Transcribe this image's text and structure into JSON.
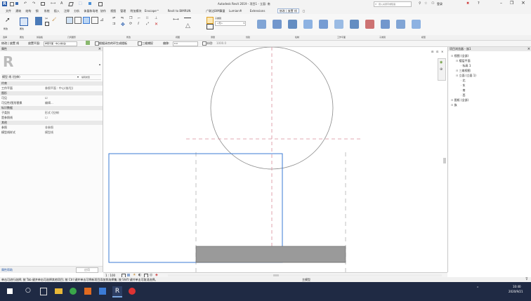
{
  "app": {
    "window_title": "Autodesk Revit 2019 - 项目1 - 立面: 南",
    "search_placeholder": "键入关键字或短语",
    "user": "登录",
    "help": "?"
  },
  "ribbon": {
    "tabs": [
      "文件",
      "建筑",
      "结构",
      "钢",
      "系统",
      "插入",
      "注释",
      "分析",
      "体量和场地",
      "协作",
      "视图",
      "管理",
      "附加模块",
      "Enscape™",
      "Revit to BIMRUN",
      "广联达BIM算量",
      "Lumion®",
      "Extensions",
      "修改 | 放置 线",
      "▢"
    ],
    "active_tab": "修改 | 放置 线",
    "groups": [
      "选择",
      "属性",
      "剪贴板",
      "几何图形",
      "修改",
      "视图",
      "测量",
      "创建",
      "绘制",
      "工作平面",
      "子类别",
      "模型"
    ],
    "commands": {
      "modify": "修改",
      "workplane": "工作平面",
      "properties_label": "属性",
      "clipboard_label": "剪贴板",
      "geometry_label": "几何图形",
      "subcategory_label": "子类别",
      "subcategory_value": "<无>",
      "draw_label": "绘制"
    }
  },
  "options_bar": {
    "modify_label": "修改 | 放置 线",
    "placement_plane_label": "放置平面:",
    "placement_plane_value": "参照平面 : 中心(前/后)",
    "chain_label": "根据闭合的环生成楼板",
    "three_d_snap": "三维捕捉",
    "offset_label": "偏移:",
    "offset_value": "0.0",
    "radius_label": "半径:",
    "radius_value": "1000.0",
    "lock_label": "锁定"
  },
  "properties": {
    "title": "属性",
    "type_selector": "模型 线 (拉伸)",
    "edit_type": "编辑类型",
    "filter_value": "模型线",
    "sections": [
      {
        "name": "约束",
        "rows": [
          {
            "k": "工作平面",
            "v": "参照平面 : 中心(前/后)"
          }
        ]
      },
      {
        "name": "图形",
        "rows": [
          {
            "k": "可见",
            "v": "☑"
          },
          {
            "k": "可见性/图形替换",
            "v": "编辑..."
          }
        ]
      },
      {
        "name": "标识数据",
        "rows": [
          {
            "k": "子类别",
            "v": "形式 (拉伸)"
          },
          {
            "k": "是参照线",
            "v": "☐"
          }
        ]
      },
      {
        "name": "其他",
        "rows": [
          {
            "k": "参照",
            "v": "非参照"
          },
          {
            "k": "模型线样式",
            "v": "模型线"
          }
        ]
      }
    ],
    "apply_link": "属性帮助",
    "apply_button": "应用"
  },
  "view": {
    "scale": "1 : 100",
    "statusbar_text": "单击可进行选择; 按 Tab 键并单击可选择其他项目; 按 Ctrl 键并单击可将新项目添加到选择集; 按 Shift 键并单击可取消选择。",
    "main_model": "主模型"
  },
  "browser": {
    "title": "项目浏览器 - 族1",
    "items": [
      {
        "level": 0,
        "label": "视图 (全部)"
      },
      {
        "level": 1,
        "label": "楼层平面"
      },
      {
        "level": 2,
        "label": "标高 1"
      },
      {
        "level": 1,
        "label": "三维视图"
      },
      {
        "level": 1,
        "label": "立面 (立面 1)"
      },
      {
        "level": 2,
        "label": "北"
      },
      {
        "level": 2,
        "label": "东"
      },
      {
        "level": 2,
        "label": "南"
      },
      {
        "level": 2,
        "label": "西"
      },
      {
        "level": 0,
        "label": "图纸 (全部)"
      },
      {
        "level": 0,
        "label": "族"
      }
    ]
  },
  "taskbar": {
    "time": "10:40",
    "date": "2020/9/21"
  },
  "colors": {
    "titlebar": "#f3f3f3",
    "ribbon_active": "#4a7ab8",
    "sketch_line": "#3b7bd6",
    "ref_plane": "#d98c9a",
    "filled_region": "#9a9a9a",
    "taskbar": "#1f2a44"
  }
}
